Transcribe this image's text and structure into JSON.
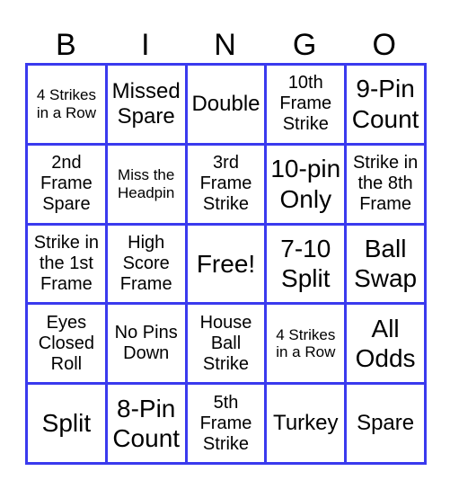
{
  "header": [
    "B",
    "I",
    "N",
    "G",
    "O"
  ],
  "colors": {
    "grid_border": "#3a3aee"
  },
  "cells": [
    [
      {
        "text": "4 Strikes in a Row",
        "size": "sm"
      },
      {
        "text": "Missed Spare",
        "size": "lg"
      },
      {
        "text": "Double",
        "size": "lg"
      },
      {
        "text": "10th Frame Strike",
        "size": "md"
      },
      {
        "text": "9-Pin Count",
        "size": "xl"
      }
    ],
    [
      {
        "text": "2nd Frame Spare",
        "size": "md"
      },
      {
        "text": "Miss the Headpin",
        "size": "sm"
      },
      {
        "text": "3rd Frame Strike",
        "size": "md"
      },
      {
        "text": "10-pin Only",
        "size": "xl"
      },
      {
        "text": "Strike in the 8th Frame",
        "size": "md"
      }
    ],
    [
      {
        "text": "Strike in the 1st Frame",
        "size": "md"
      },
      {
        "text": "High Score Frame",
        "size": "md"
      },
      {
        "text": "Free!",
        "size": "xl"
      },
      {
        "text": "7-10 Split",
        "size": "xl"
      },
      {
        "text": "Ball Swap",
        "size": "xl"
      }
    ],
    [
      {
        "text": "Eyes Closed Roll",
        "size": "md"
      },
      {
        "text": "No Pins Down",
        "size": "md"
      },
      {
        "text": "House Ball Strike",
        "size": "md"
      },
      {
        "text": "4 Strikes in a Row",
        "size": "sm"
      },
      {
        "text": "All Odds",
        "size": "xl"
      }
    ],
    [
      {
        "text": "Split",
        "size": "xl"
      },
      {
        "text": "8-Pin Count",
        "size": "xl"
      },
      {
        "text": "5th Frame Strike",
        "size": "md"
      },
      {
        "text": "Turkey",
        "size": "lg"
      },
      {
        "text": "Spare",
        "size": "lg"
      }
    ]
  ]
}
